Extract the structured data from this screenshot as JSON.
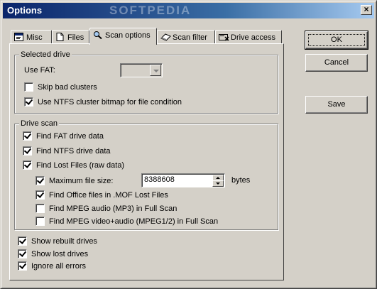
{
  "window": {
    "title": "Options",
    "watermark": "SOFTPEDIA",
    "close_label": "×"
  },
  "tabs": [
    {
      "label": "Misc",
      "icon": "misc-icon"
    },
    {
      "label": "Files",
      "icon": "file-icon"
    },
    {
      "label": "Scan options",
      "icon": "scan-icon",
      "active": true
    },
    {
      "label": "Scan filter",
      "icon": "eraser-icon"
    },
    {
      "label": "Drive access",
      "icon": "drive-access-icon"
    }
  ],
  "selected_drive": {
    "title": "Selected drive",
    "use_fat_label": "Use FAT:",
    "use_fat_value": "",
    "skip_bad_clusters": {
      "label": "Skip bad clusters",
      "checked": false
    },
    "use_ntfs_bitmap": {
      "label": "Use NTFS cluster bitmap for file condition",
      "checked": true
    }
  },
  "drive_scan": {
    "title": "Drive scan",
    "find_fat": {
      "label": "Find FAT drive data",
      "checked": true
    },
    "find_ntfs": {
      "label": "Find NTFS drive data",
      "checked": true
    },
    "find_lost": {
      "label": "Find Lost Files (raw data)",
      "checked": true
    },
    "max_file_size": {
      "label": "Maximum file size:",
      "checked": true,
      "value": "8388608",
      "unit": "bytes"
    },
    "find_office": {
      "label": "Find Office files in .MOF Lost Files",
      "checked": true
    },
    "find_mp3": {
      "label": "Find MPEG audio (MP3) in Full Scan",
      "checked": false
    },
    "find_mpeg": {
      "label": "Find MPEG video+audio (MPEG1/2) in Full Scan",
      "checked": false
    }
  },
  "bottom": {
    "show_rebuilt": {
      "label": "Show rebuilt drives",
      "checked": true
    },
    "show_lost": {
      "label": "Show lost drives",
      "checked": true
    },
    "ignore_errors": {
      "label": "Ignore all errors",
      "checked": true
    }
  },
  "buttons": {
    "ok": "OK",
    "cancel": "Cancel",
    "save": "Save"
  }
}
